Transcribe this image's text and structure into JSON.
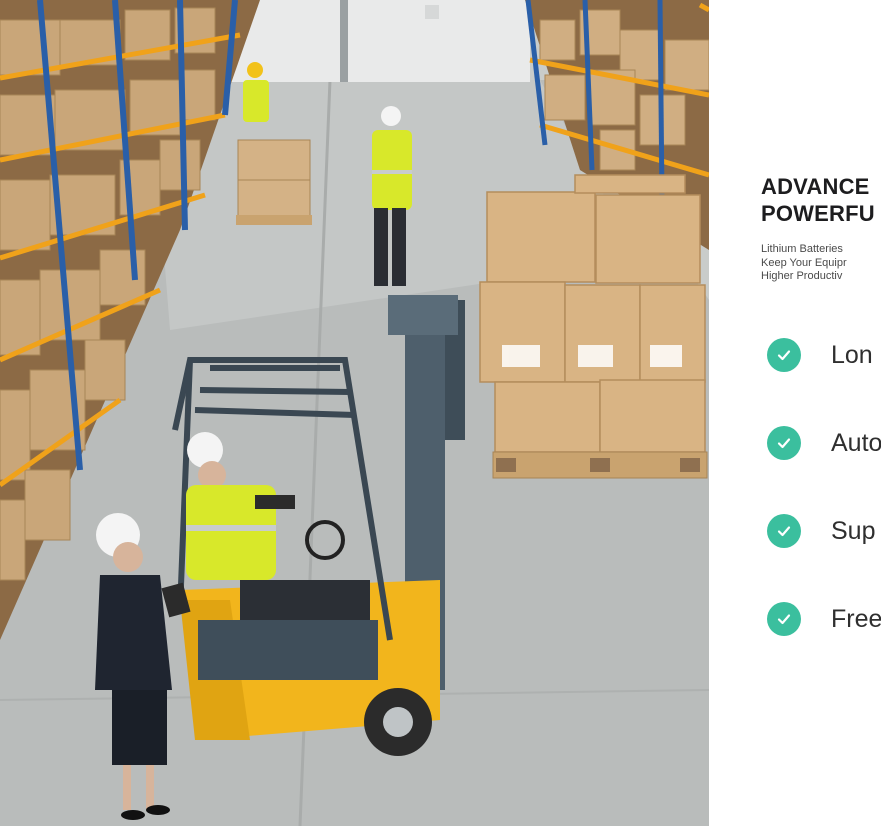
{
  "photo": {
    "alt": "Warehouse workers with forklift lifting pallet of boxes"
  },
  "card": {
    "headline_line1": "ADVANCE",
    "headline_line2": "POWERFU",
    "subtext_line1": "Lithium Batteries",
    "subtext_line2": "Keep Your Equipr",
    "subtext_line3": "Higher Productiv",
    "features": [
      {
        "label": "Lon",
        "icon": "check-circle-icon"
      },
      {
        "label": "Auto",
        "icon": "check-circle-icon"
      },
      {
        "label": "Sup",
        "icon": "check-circle-icon"
      },
      {
        "label": "Free",
        "icon": "check-circle-icon"
      }
    ]
  },
  "colors": {
    "accent": "#3bbf9e",
    "forklift": "#f2b51c",
    "rack_blue": "#2a5fa8",
    "rack_orange": "#f0a21a",
    "vest": "#d8e82a"
  }
}
